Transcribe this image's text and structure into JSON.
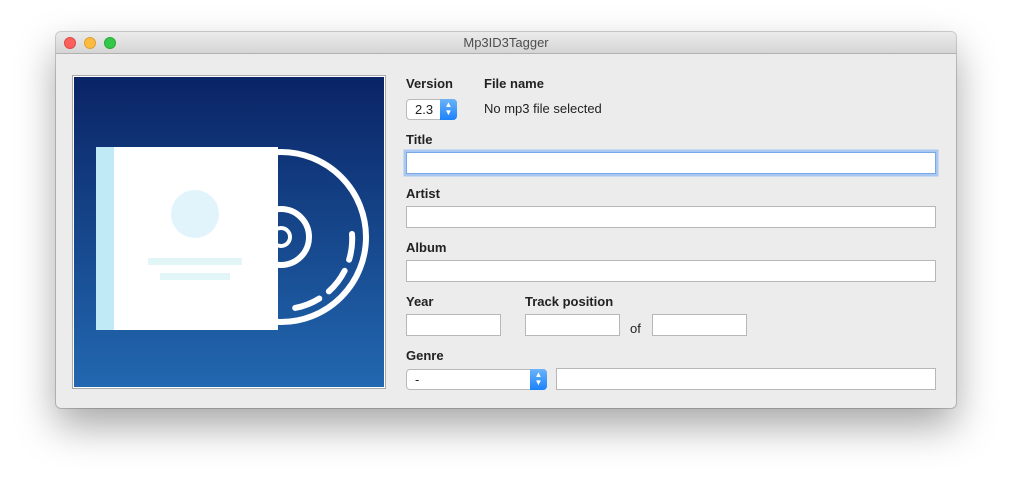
{
  "window": {
    "title": "Mp3ID3Tagger"
  },
  "version": {
    "label": "Version",
    "value": "2.3"
  },
  "file_name": {
    "label": "File name",
    "value": "No mp3 file selected"
  },
  "title_field": {
    "label": "Title",
    "value": ""
  },
  "artist_field": {
    "label": "Artist",
    "value": ""
  },
  "album_field": {
    "label": "Album",
    "value": ""
  },
  "year_field": {
    "label": "Year",
    "value": ""
  },
  "track": {
    "label": "Track position",
    "of_label": "of",
    "position": "",
    "total": ""
  },
  "genre": {
    "label": "Genre",
    "selected": "-",
    "custom": ""
  },
  "icons": {
    "artwork": "album-cd-placeholder-icon",
    "popup_arrows": "chevron-up-down-icon"
  },
  "colors": {
    "accent": "#1a82fb",
    "art_gradient_top": "#0a2466",
    "art_gradient_bottom": "#2268b0"
  }
}
